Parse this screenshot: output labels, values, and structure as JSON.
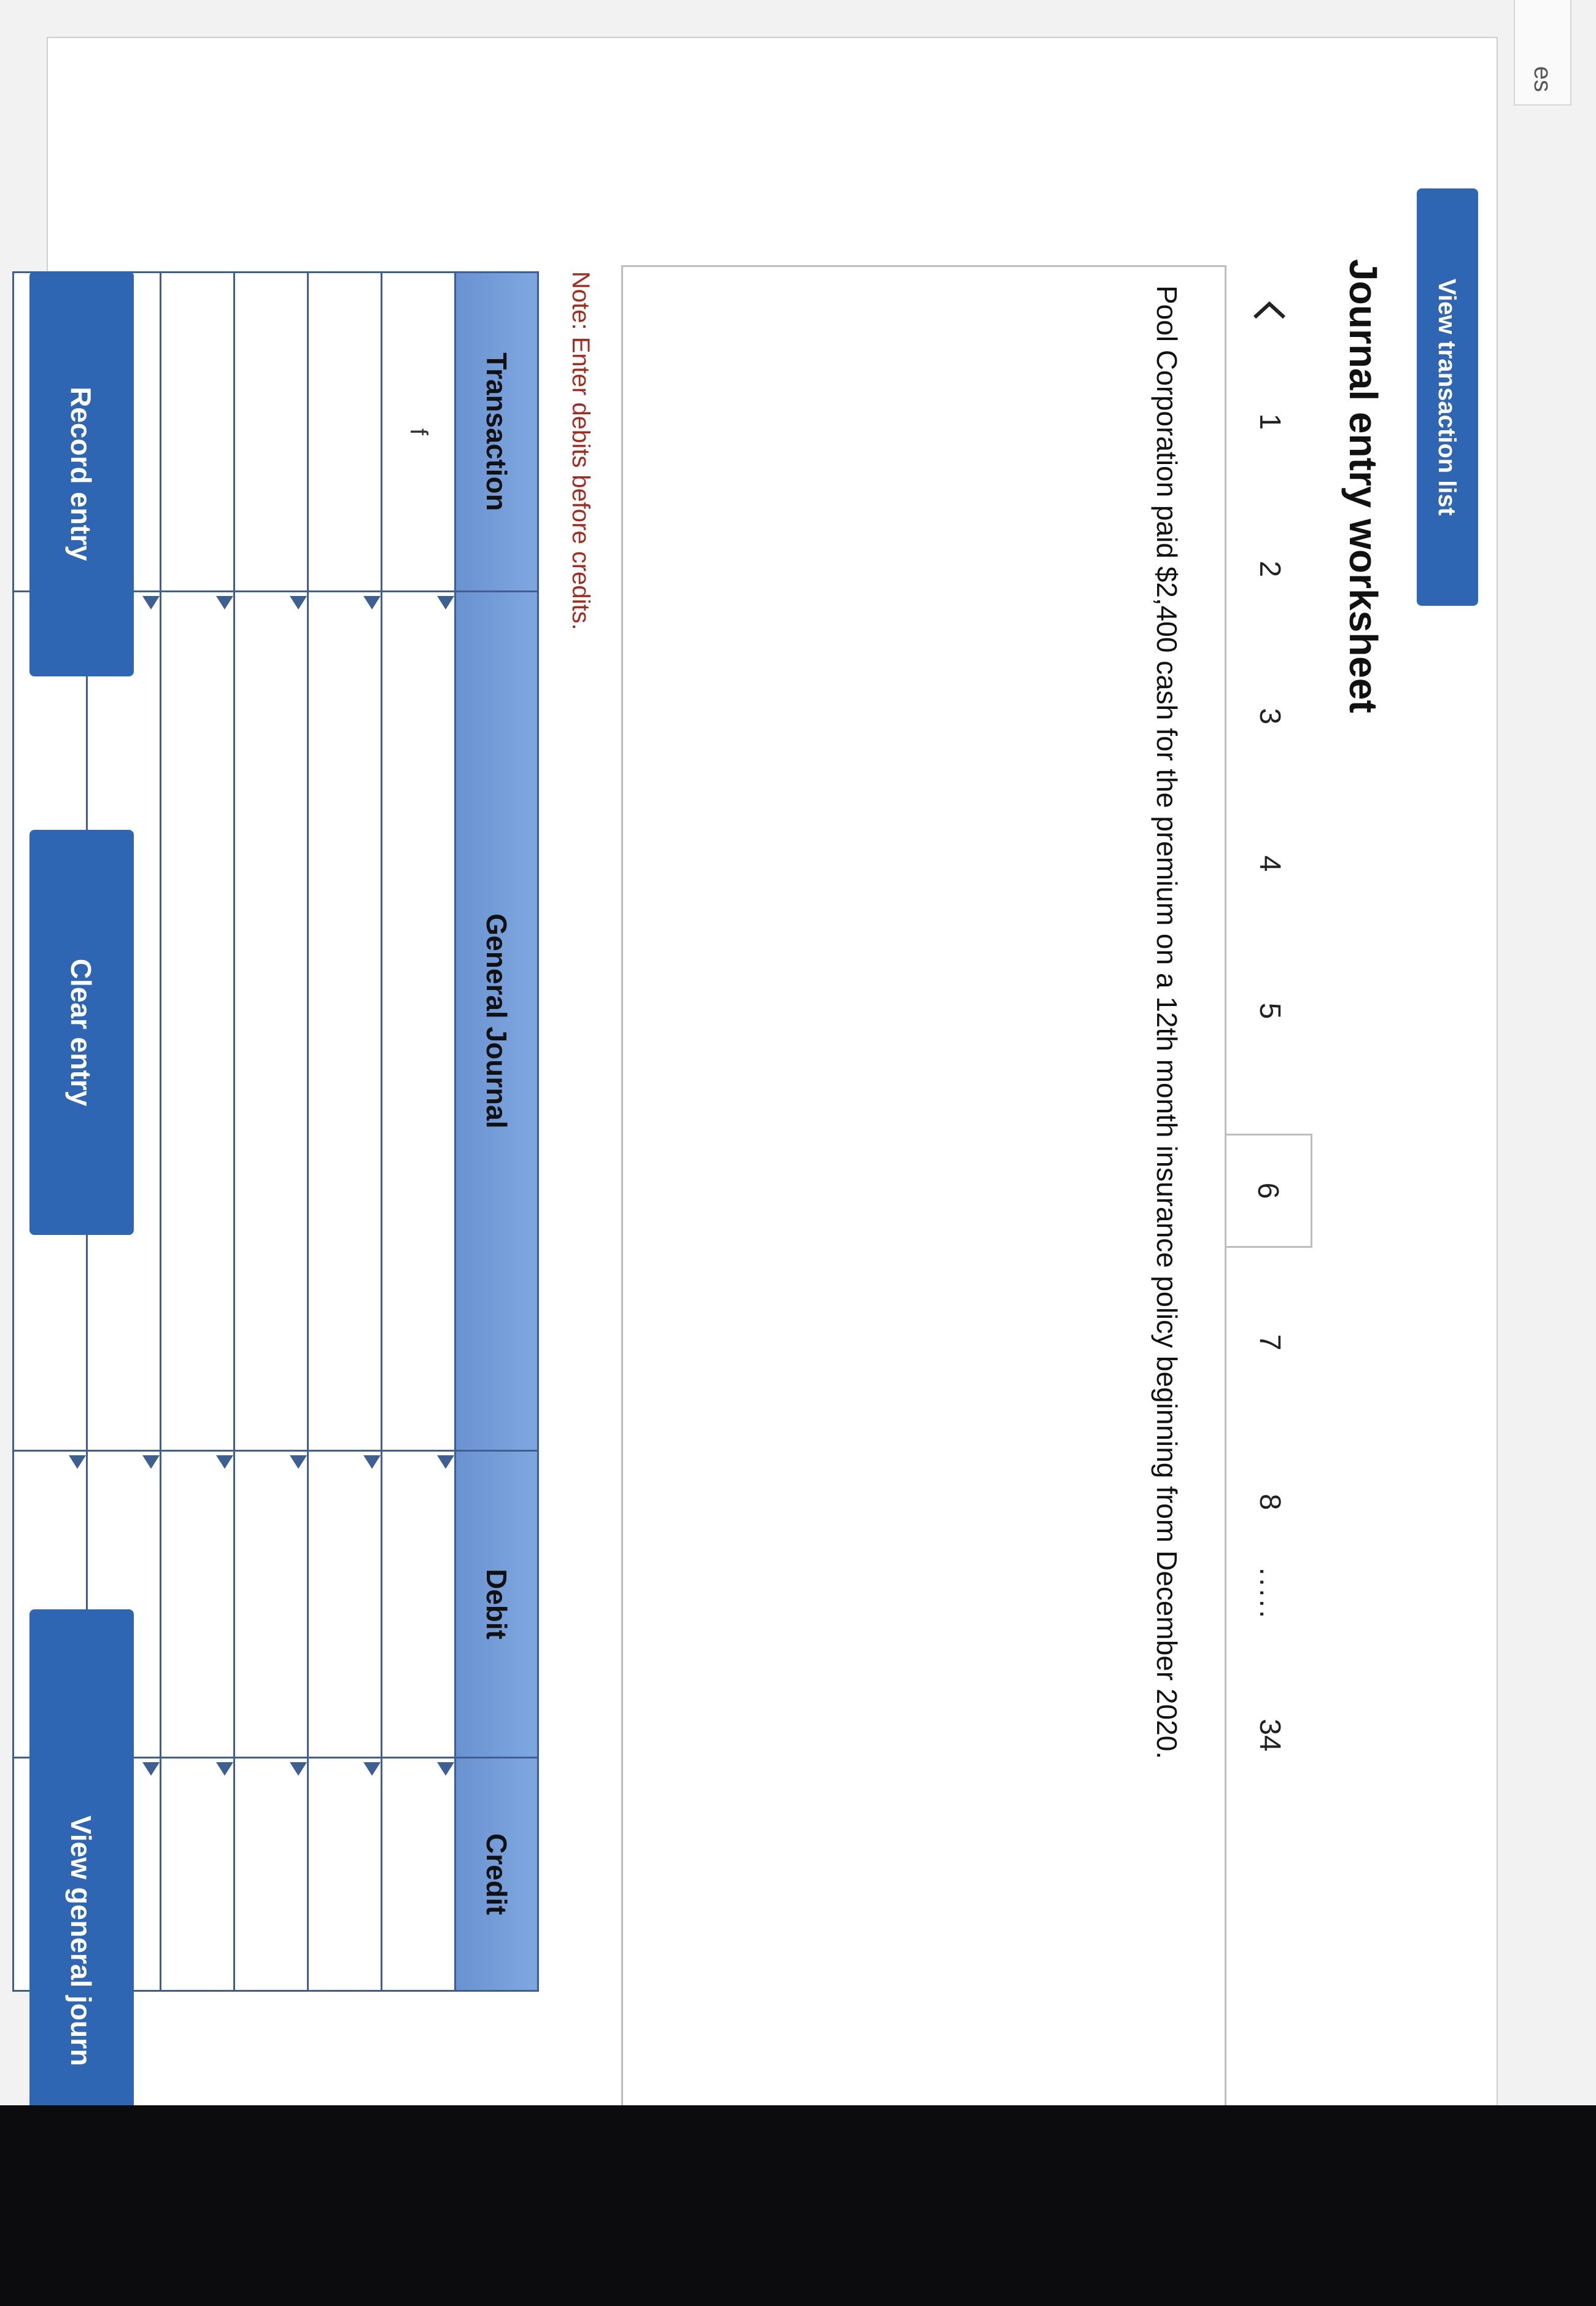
{
  "tabs": {
    "partial_label": "es"
  },
  "toolbar": {
    "view_transaction_list": "View transaction list"
  },
  "worksheet": {
    "title": "Journal entry worksheet",
    "prev_icon": "chevron-left-icon",
    "pages": [
      "1",
      "2",
      "3",
      "4",
      "5",
      "6",
      "7",
      "8",
      ".....",
      "34"
    ],
    "active_page": "6",
    "prompt": "Pool Corporation paid $2,400 cash for the premium on a 12th month insurance policy beginning from December 2020.",
    "note": "Note: Enter debits before credits."
  },
  "journal": {
    "headers": {
      "transaction": "Transaction",
      "general_journal": "General Journal",
      "debit": "Debit",
      "credit": "Credit"
    },
    "rows": [
      {
        "transaction": "f",
        "account": "",
        "debit": "",
        "credit": ""
      },
      {
        "transaction": "",
        "account": "",
        "debit": "",
        "credit": ""
      },
      {
        "transaction": "",
        "account": "",
        "debit": "",
        "credit": ""
      },
      {
        "transaction": "",
        "account": "",
        "debit": "",
        "credit": ""
      },
      {
        "transaction": "",
        "account": "",
        "debit": "",
        "credit": ""
      },
      {
        "transaction": "",
        "account": "",
        "debit": "",
        "credit": ""
      }
    ]
  },
  "buttons": {
    "record_entry": "Record entry",
    "clear_entry": "Clear entry",
    "view_general_journal": "View general journ"
  },
  "colors": {
    "accent": "#2f66b3",
    "table_header": "#7fa7df",
    "table_border": "#3e5f92",
    "note_text": "#a32a1e"
  }
}
